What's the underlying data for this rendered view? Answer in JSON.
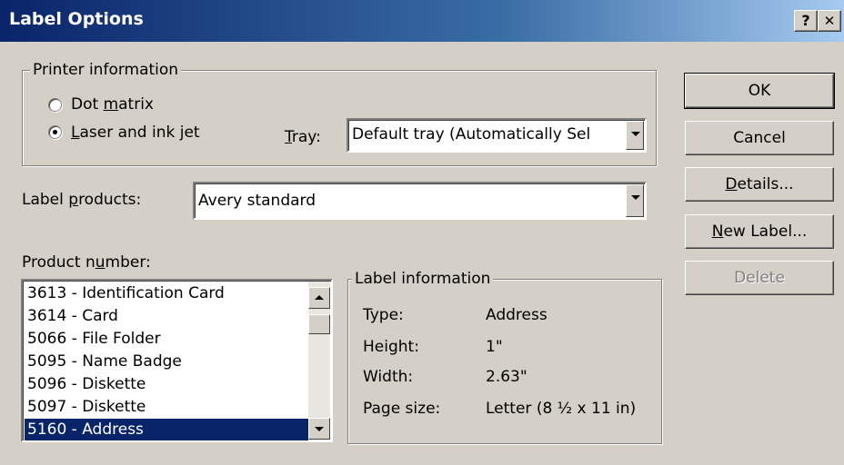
{
  "window": {
    "title": "Label Options",
    "help_glyph": "?",
    "close_glyph": "✕"
  },
  "printer_info": {
    "legend": "Printer information",
    "dot_matrix": {
      "pre": "Dot ",
      "key": "m",
      "post": "atrix"
    },
    "laser": {
      "pre": "",
      "key": "L",
      "post": "aser and ink jet"
    },
    "selected": "laser",
    "tray_label": {
      "pre": "",
      "key": "T",
      "post": "ray:"
    },
    "tray_value": "Default tray (Automatically Sel"
  },
  "label_products": {
    "label": {
      "pre": "Label ",
      "key": "p",
      "post": "roducts:"
    },
    "value": "Avery standard"
  },
  "product_number": {
    "label": {
      "pre": "Product n",
      "key": "u",
      "post": "mber:"
    },
    "items": [
      "3613 - Identification Card",
      "3614 - Card",
      "5066 - File Folder",
      "5095 - Name Badge",
      "5096 - Diskette",
      "5097 - Diskette",
      "5160 - Address"
    ],
    "selected_index": 6
  },
  "label_info": {
    "legend": "Label information",
    "rows": [
      {
        "key": "Type:",
        "value": "Address"
      },
      {
        "key": "Height:",
        "value": "1\""
      },
      {
        "key": "Width:",
        "value": "2.63\""
      },
      {
        "key": "Page size:",
        "value": "Letter (8 ½ x 11 in)"
      }
    ]
  },
  "buttons": {
    "ok": "OK",
    "cancel": "Cancel",
    "details": {
      "pre": "",
      "key": "D",
      "post": "etails..."
    },
    "new_label": {
      "pre": "",
      "key": "N",
      "post": "ew Label..."
    },
    "delete": "Delete"
  }
}
